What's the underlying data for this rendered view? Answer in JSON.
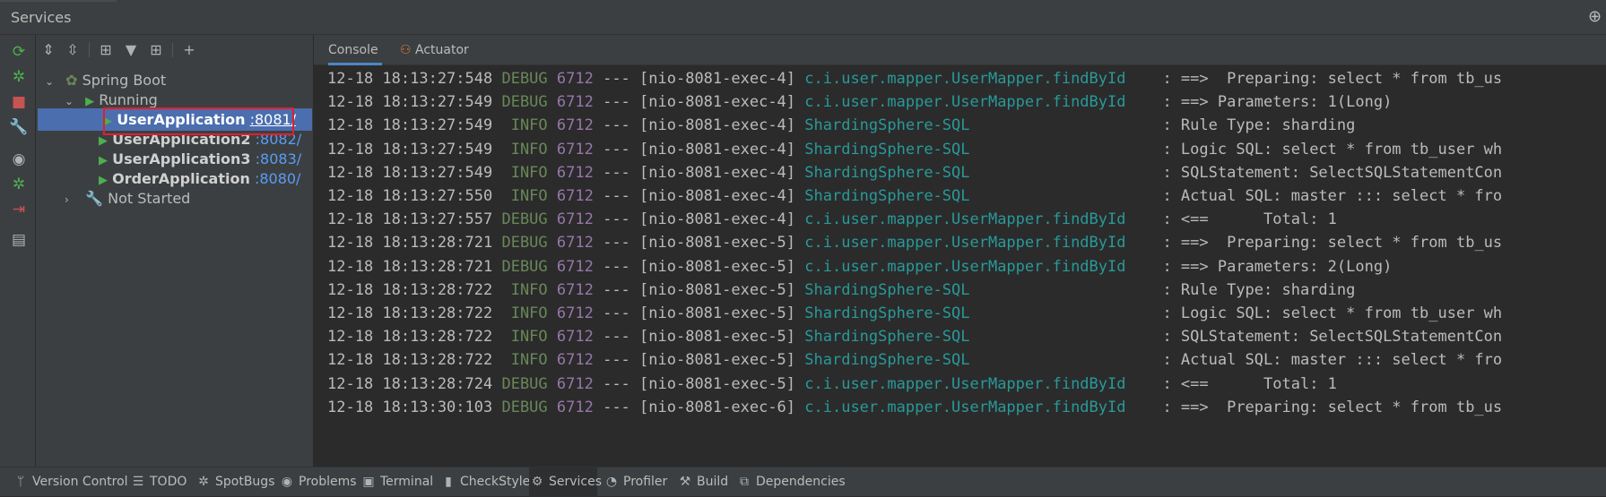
{
  "window": {
    "title": "Services"
  },
  "left_strip_icons": [
    "refresh-icon",
    "bug-run-icon",
    "stop-icon",
    "wrench-icon",
    "camera-icon",
    "debug-icon",
    "login-icon",
    "layout-icon"
  ],
  "tree_toolbar_icons": [
    "expand-all-icon",
    "collapse-all-icon",
    "group-icon",
    "filter-icon",
    "new-tab-icon",
    "add-icon"
  ],
  "tree": {
    "root_label": "Spring Boot",
    "running_label": "Running",
    "apps": [
      {
        "name": "UserApplication",
        "port": ":8081/"
      },
      {
        "name": "UserApplication2",
        "port": ":8082/"
      },
      {
        "name": "UserApplication3",
        "port": ":8083/"
      },
      {
        "name": "OrderApplication",
        "port": ":8080/"
      }
    ],
    "not_started_label": "Not Started"
  },
  "console_tabs": [
    "Console",
    "Actuator"
  ],
  "log_lines": [
    {
      "ts": "12-18 18:13:27:548",
      "level": "DEBUG",
      "pid": "6712",
      "thread": "[nio-8081-exec-4]",
      "logger": "c.i.user.mapper.UserMapper.findById",
      "msg": ": ==>  Preparing: select * from tb_us"
    },
    {
      "ts": "12-18 18:13:27:549",
      "level": "DEBUG",
      "pid": "6712",
      "thread": "[nio-8081-exec-4]",
      "logger": "c.i.user.mapper.UserMapper.findById",
      "msg": ": ==> Parameters: 1(Long)"
    },
    {
      "ts": "12-18 18:13:27:549",
      "level": " INFO",
      "pid": "6712",
      "thread": "[nio-8081-exec-4]",
      "logger": "ShardingSphere-SQL",
      "msg": ": Rule Type: sharding"
    },
    {
      "ts": "12-18 18:13:27:549",
      "level": " INFO",
      "pid": "6712",
      "thread": "[nio-8081-exec-4]",
      "logger": "ShardingSphere-SQL",
      "msg": ": Logic SQL: select * from tb_user wh"
    },
    {
      "ts": "12-18 18:13:27:549",
      "level": " INFO",
      "pid": "6712",
      "thread": "[nio-8081-exec-4]",
      "logger": "ShardingSphere-SQL",
      "msg": ": SQLStatement: SelectSQLStatementCon"
    },
    {
      "ts": "12-18 18:13:27:550",
      "level": " INFO",
      "pid": "6712",
      "thread": "[nio-8081-exec-4]",
      "logger": "ShardingSphere-SQL",
      "msg": ": Actual SQL: master ::: select * fro"
    },
    {
      "ts": "12-18 18:13:27:557",
      "level": "DEBUG",
      "pid": "6712",
      "thread": "[nio-8081-exec-4]",
      "logger": "c.i.user.mapper.UserMapper.findById",
      "msg": ": <==      Total: 1"
    },
    {
      "ts": "12-18 18:13:28:721",
      "level": "DEBUG",
      "pid": "6712",
      "thread": "[nio-8081-exec-5]",
      "logger": "c.i.user.mapper.UserMapper.findById",
      "msg": ": ==>  Preparing: select * from tb_us"
    },
    {
      "ts": "12-18 18:13:28:721",
      "level": "DEBUG",
      "pid": "6712",
      "thread": "[nio-8081-exec-5]",
      "logger": "c.i.user.mapper.UserMapper.findById",
      "msg": ": ==> Parameters: 2(Long)"
    },
    {
      "ts": "12-18 18:13:28:722",
      "level": " INFO",
      "pid": "6712",
      "thread": "[nio-8081-exec-5]",
      "logger": "ShardingSphere-SQL",
      "msg": ": Rule Type: sharding"
    },
    {
      "ts": "12-18 18:13:28:722",
      "level": " INFO",
      "pid": "6712",
      "thread": "[nio-8081-exec-5]",
      "logger": "ShardingSphere-SQL",
      "msg": ": Logic SQL: select * from tb_user wh"
    },
    {
      "ts": "12-18 18:13:28:722",
      "level": " INFO",
      "pid": "6712",
      "thread": "[nio-8081-exec-5]",
      "logger": "ShardingSphere-SQL",
      "msg": ": SQLStatement: SelectSQLStatementCon"
    },
    {
      "ts": "12-18 18:13:28:722",
      "level": " INFO",
      "pid": "6712",
      "thread": "[nio-8081-exec-5]",
      "logger": "ShardingSphere-SQL",
      "msg": ": Actual SQL: master ::: select * fro"
    },
    {
      "ts": "12-18 18:13:28:724",
      "level": "DEBUG",
      "pid": "6712",
      "thread": "[nio-8081-exec-5]",
      "logger": "c.i.user.mapper.UserMapper.findById",
      "msg": ": <==      Total: 1"
    },
    {
      "ts": "12-18 18:13:30:103",
      "level": "DEBUG",
      "pid": "6712",
      "thread": "[nio-8081-exec-6]",
      "logger": "c.i.user.mapper.UserMapper.findById",
      "msg": ": ==>  Preparing: select * from tb_us"
    }
  ],
  "bottom_tabs": [
    {
      "label": "Version Control",
      "icon": "branch-icon"
    },
    {
      "label": "TODO",
      "icon": "list-icon"
    },
    {
      "label": "SpotBugs",
      "icon": "bug-icon"
    },
    {
      "label": "Problems",
      "icon": "problems-icon"
    },
    {
      "label": "Terminal",
      "icon": "terminal-icon"
    },
    {
      "label": "CheckStyle",
      "icon": "checkstyle-icon"
    },
    {
      "label": "Services",
      "icon": "services-icon",
      "active": true
    },
    {
      "label": "Profiler",
      "icon": "profiler-icon"
    },
    {
      "label": "Build",
      "icon": "hammer-icon"
    },
    {
      "label": "Dependencies",
      "icon": "dependencies-icon"
    }
  ],
  "colors": {
    "selection": "#4b6eaf",
    "highlight_box": "#e0202a",
    "debug_level": "#6a8759",
    "pid": "#9876aa",
    "logger": "#299999",
    "port_link": "#589df6"
  }
}
